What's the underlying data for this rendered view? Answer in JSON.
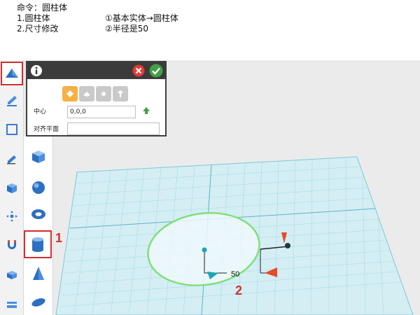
{
  "header": {
    "command": "命令：圆柱体",
    "step1": "1.圆柱体",
    "step1_detail": "①基本实体→圆柱体",
    "step2": "2.尺寸修改",
    "step2_detail": "②半径是50"
  },
  "toolbar": {
    "items": [
      {
        "icon": "basic-shapes-icon",
        "active": true
      },
      {
        "icon": "sketch-pen-icon",
        "active": false
      },
      {
        "icon": "sketch-square-icon",
        "active": false
      },
      {
        "icon": "edit-pencil-icon",
        "active": false
      },
      {
        "icon": "combine-cube-icon",
        "active": false
      },
      {
        "icon": "move-arrows-icon",
        "active": false
      },
      {
        "icon": "magnet-icon",
        "active": false
      },
      {
        "icon": "group-cube-icon",
        "active": false
      },
      {
        "icon": "layer-box-icon",
        "active": false
      }
    ]
  },
  "shape_panel": {
    "items": [
      {
        "icon": "cube-icon",
        "active": false
      },
      {
        "icon": "sphere-icon",
        "active": false
      },
      {
        "icon": "torus-icon",
        "active": false
      },
      {
        "icon": "cylinder-icon",
        "active": true
      },
      {
        "icon": "cone-icon",
        "active": false
      },
      {
        "icon": "ellipsoid-icon",
        "active": false
      }
    ]
  },
  "dialog": {
    "center_label": "中心",
    "center_value": "0,0,0",
    "align_label": "对齐平面",
    "align_value": "",
    "mode_count": 4,
    "active_mode": 0
  },
  "annotations": {
    "marker_1": "1",
    "marker_2": "2",
    "radius_value": "50"
  },
  "colors": {
    "highlight_red": "#d32f2f",
    "grid_cyan": "#9fd9e6",
    "cylinder_outline": "#7ee07a",
    "dialog_bar": "#3b3b3b",
    "active_mode": "#f7b045"
  }
}
